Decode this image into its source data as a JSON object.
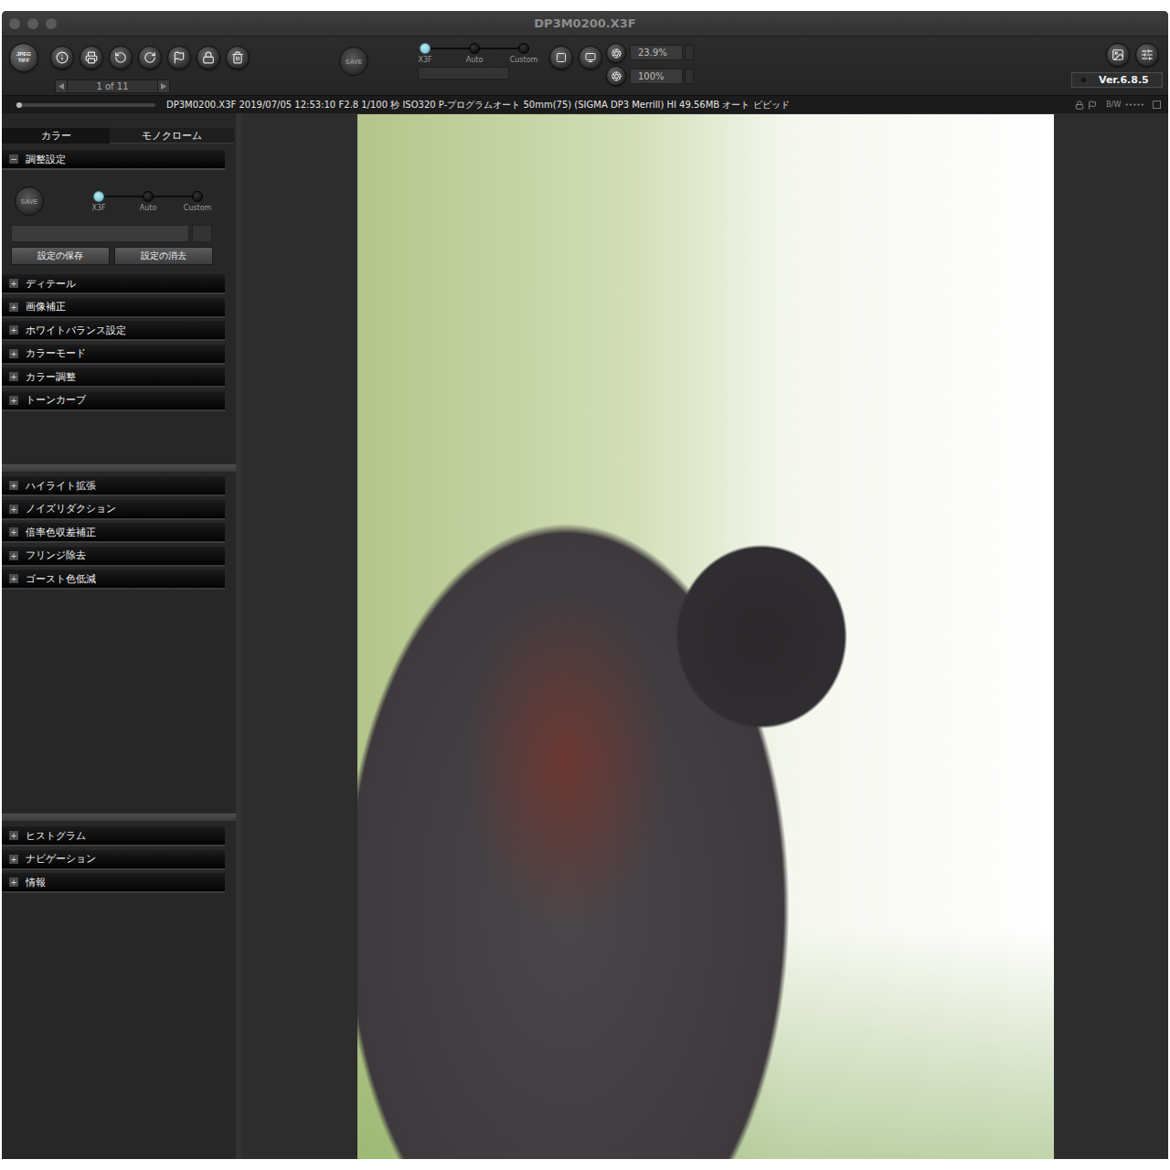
{
  "window": {
    "title": "DP3M0200.X3F"
  },
  "toolbar": {
    "export_label": [
      "JPEG",
      "TIFF"
    ],
    "save_label": "SAVE",
    "page": "1 of 11",
    "mode_slider": [
      {
        "label": "X3F",
        "selected": true
      },
      {
        "label": "Auto",
        "selected": false
      },
      {
        "label": "Custom",
        "selected": false
      }
    ],
    "zoom_fit": "23.9%",
    "zoom_actual": "100%",
    "version": "Ver.6.8.5"
  },
  "info_bar": {
    "progress_level": 0,
    "text": "DP3M0200.X3F 2019/07/05 12:53:10 F2.8 1/100 秒 ISO320 P-プログラムオート 50mm(75) (SIGMA DP3 Merrill) HI 49.56MB オート ビビッド",
    "bw_label": "B/W",
    "dots": "• • • • •"
  },
  "panel": {
    "tabs": [
      {
        "label": "カラー",
        "selected": true
      },
      {
        "label": "モノクローム",
        "selected": false
      }
    ],
    "adjust": {
      "title": "調整設定",
      "toggle": "−",
      "expanded": true,
      "save_label": "SAVE",
      "mode_slider": [
        {
          "label": "X3F",
          "selected": true
        },
        {
          "label": "Auto",
          "selected": false
        },
        {
          "label": "Custom",
          "selected": false
        }
      ],
      "buttons": [
        "設定の保存",
        "設定の消去"
      ]
    },
    "groups": [
      {
        "sections": [
          {
            "title": "ディテール",
            "toggle": "+",
            "expanded": false
          },
          {
            "title": "画像補正",
            "toggle": "+",
            "expanded": false
          },
          {
            "title": "ホワイトバランス設定",
            "toggle": "+",
            "expanded": false
          },
          {
            "title": "カラーモード",
            "toggle": "+",
            "expanded": false
          },
          {
            "title": "カラー調整",
            "toggle": "+",
            "expanded": false
          },
          {
            "title": "トーンカーブ",
            "toggle": "+",
            "expanded": false
          }
        ]
      },
      {
        "sections": [
          {
            "title": "ハイライト拡張",
            "toggle": "+",
            "expanded": false
          },
          {
            "title": "ノイズリダクション",
            "toggle": "+",
            "expanded": false
          },
          {
            "title": "倍率色収差補正",
            "toggle": "+",
            "expanded": false
          },
          {
            "title": "フリンジ除去",
            "toggle": "+",
            "expanded": false
          },
          {
            "title": "ゴースト色低減",
            "toggle": "+",
            "expanded": false
          }
        ]
      },
      {
        "sections": [
          {
            "title": "ヒストグラム",
            "toggle": "+",
            "expanded": false
          },
          {
            "title": "ナビゲーション",
            "toggle": "+",
            "expanded": false
          },
          {
            "title": "情報",
            "toggle": "+",
            "expanded": false
          }
        ]
      }
    ]
  }
}
